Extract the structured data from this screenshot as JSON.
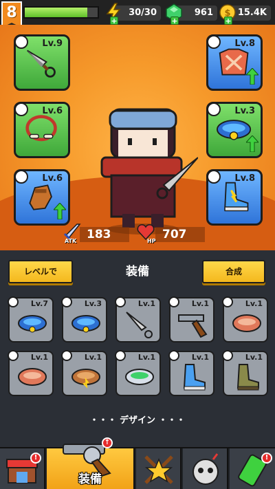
{
  "player": {
    "level": "8",
    "xp_fraction": 0.86
  },
  "resources": {
    "energy": "30/30",
    "gems": "961",
    "coins": "15.4K"
  },
  "equipped": {
    "left": [
      {
        "slot": "weapon",
        "icon": "kunai-icon",
        "level": "Lv.9",
        "rarity": "green"
      },
      {
        "slot": "necklace",
        "icon": "bone-necklace-icon",
        "level": "Lv.6",
        "rarity": "green"
      },
      {
        "slot": "gloves",
        "icon": "glove-icon",
        "level": "Lv.6",
        "rarity": "blue",
        "upgradable": true
      }
    ],
    "right": [
      {
        "slot": "armor",
        "icon": "armor-icon",
        "level": "Lv.8",
        "rarity": "blue",
        "upgradable": true
      },
      {
        "slot": "belt",
        "icon": "belt-icon",
        "level": "Lv.3",
        "rarity": "green",
        "upgradable": true
      },
      {
        "slot": "boots",
        "icon": "boots-icon",
        "level": "Lv.8",
        "rarity": "blue"
      }
    ]
  },
  "stats": {
    "atk_label": "ATK",
    "atk": "183",
    "hp_label": "HP",
    "hp": "707"
  },
  "panel": {
    "left_button": "レベルで",
    "title": "装備",
    "right_button": "合成"
  },
  "inventory": [
    {
      "icon": "blue-belt-icon",
      "level": "Lv.7"
    },
    {
      "icon": "blue-belt-icon",
      "level": "Lv.3"
    },
    {
      "icon": "kunai-icon",
      "level": "Lv.1"
    },
    {
      "icon": "revolver-icon",
      "level": "Lv.1"
    },
    {
      "icon": "leather-belt-icon",
      "level": "Lv.1"
    },
    {
      "icon": "leather-belt-icon",
      "level": "Lv.1"
    },
    {
      "icon": "brown-belt-icon",
      "level": "Lv.1"
    },
    {
      "icon": "green-belt-icon",
      "level": "Lv.1"
    },
    {
      "icon": "blue-boots-icon",
      "level": "Lv.1"
    },
    {
      "icon": "brown-boots-icon",
      "level": "Lv.1"
    }
  ],
  "design_label": "・・・ デザイン ・・・",
  "nav": {
    "active_label": "装備"
  },
  "colors": {
    "hero_bg": "#f69a2b",
    "green_rarity": "#4fbf3f",
    "blue_rarity": "#3a8af0",
    "accent_yellow": "#f4b81e"
  }
}
